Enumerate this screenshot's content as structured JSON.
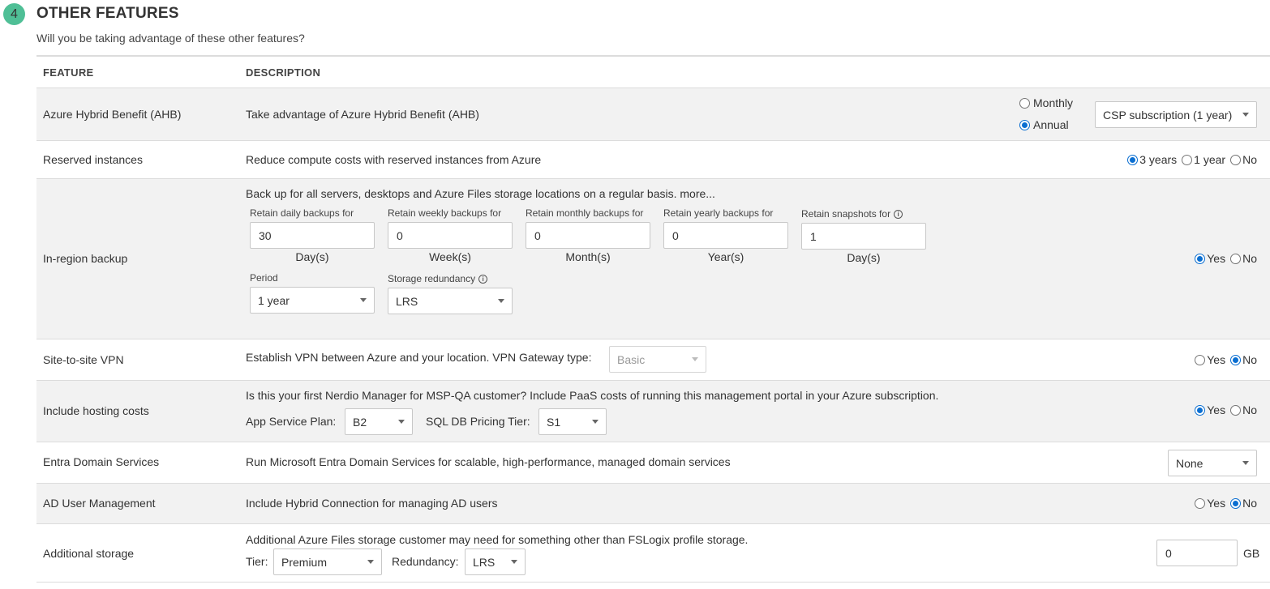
{
  "section": {
    "number": "4",
    "title": "OTHER FEATURES",
    "subtitle": "Will you be taking advantage of these other features?"
  },
  "table": {
    "headers": {
      "feature": "FEATURE",
      "description": "DESCRIPTION"
    }
  },
  "rows": {
    "ahb": {
      "feature": "Azure Hybrid Benefit (AHB)",
      "description": "Take advantage of Azure Hybrid Benefit (AHB)",
      "billing_monthly": "Monthly",
      "billing_annual": "Annual",
      "billing_selected": "Annual",
      "subscription_select": "CSP subscription (1 year)"
    },
    "reserved": {
      "feature": "Reserved instances",
      "description": "Reduce compute costs with reserved instances from Azure",
      "opt_3years": "3 years",
      "opt_1year": "1 year",
      "opt_no": "No",
      "selected": "3 years"
    },
    "backup": {
      "feature": "In-region backup",
      "description": "Back up for all servers, desktops and Azure Files storage locations on a regular basis. more...",
      "fields": [
        {
          "label": "Retain daily backups for",
          "value": "30",
          "unit": "Day(s)"
        },
        {
          "label": "Retain weekly backups for",
          "value": "0",
          "unit": "Week(s)"
        },
        {
          "label": "Retain monthly backups for",
          "value": "0",
          "unit": "Month(s)"
        },
        {
          "label": "Retain yearly backups for",
          "value": "0",
          "unit": "Year(s)"
        },
        {
          "label": "Retain snapshots for",
          "value": "1",
          "unit": "Day(s)"
        }
      ],
      "period_label": "Period",
      "period_value": "1 year",
      "redundancy_label": "Storage redundancy",
      "redundancy_value": "LRS",
      "opt_yes": "Yes",
      "opt_no": "No",
      "selected": "Yes"
    },
    "vpn": {
      "feature": "Site-to-site VPN",
      "description": "Establish VPN between Azure and your location. VPN Gateway type:",
      "gateway_value": "Basic",
      "opt_yes": "Yes",
      "opt_no": "No",
      "selected": "No"
    },
    "hosting": {
      "feature": "Include hosting costs",
      "description": "Is this your first Nerdio Manager for MSP-QA customer? Include PaaS costs of running this management portal in your Azure subscription.",
      "app_plan_label": "App Service Plan:",
      "app_plan_value": "B2",
      "sql_tier_label": "SQL DB Pricing Tier:",
      "sql_tier_value": "S1",
      "opt_yes": "Yes",
      "opt_no": "No",
      "selected": "Yes"
    },
    "entra": {
      "feature": "Entra Domain Services",
      "description": "Run Microsoft Entra Domain Services for scalable, high-performance, managed domain services",
      "select_value": "None"
    },
    "aduser": {
      "feature": "AD User Management",
      "description": "Include Hybrid Connection for managing AD users",
      "opt_yes": "Yes",
      "opt_no": "No",
      "selected": "No"
    },
    "storage": {
      "feature": "Additional storage",
      "description": "Additional Azure Files storage customer may need for something other than FSLogix profile storage.",
      "tier_label": "Tier:",
      "tier_value": "Premium",
      "redundancy_label": "Redundancy:",
      "redundancy_value": "LRS",
      "amount_value": "0",
      "amount_unit": "GB"
    }
  },
  "colors": {
    "accent_badge": "#4fbf96",
    "radio_selected": "#0a6ed1",
    "row_alt": "#f2f2f2"
  }
}
